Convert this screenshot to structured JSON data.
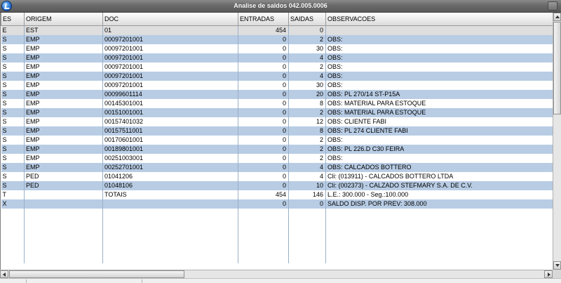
{
  "window": {
    "title": "Analise de saldos 042.005.0006"
  },
  "columns": [
    "ES",
    "ORIGEM",
    "DOC",
    "ENTRADAS",
    "SAIDAS",
    "OBSERVACOES"
  ],
  "rows": [
    [
      "E",
      "EST",
      "01",
      "454",
      "0",
      ""
    ],
    [
      "S",
      "EMP",
      "00097201001",
      "0",
      "2",
      "OBS:"
    ],
    [
      "S",
      "EMP",
      "00097201001",
      "0",
      "30",
      "OBS:"
    ],
    [
      "S",
      "EMP",
      "00097201001",
      "0",
      "4",
      "OBS:"
    ],
    [
      "S",
      "EMP",
      "00097201001",
      "0",
      "2",
      "OBS:"
    ],
    [
      "S",
      "EMP",
      "00097201001",
      "0",
      "4",
      "OBS:"
    ],
    [
      "S",
      "EMP",
      "00097201001",
      "0",
      "30",
      "OBS:"
    ],
    [
      "S",
      "EMP",
      "00099601114",
      "0",
      "20",
      "OBS: PL 270/14 ST-P15A"
    ],
    [
      "S",
      "EMP",
      "00145301001",
      "0",
      "8",
      "OBS: MATERIAL PARA ESTOQUE"
    ],
    [
      "S",
      "EMP",
      "00151001001",
      "0",
      "2",
      "OBS: MATERIAL PARA ESTOQUE"
    ],
    [
      "S",
      "EMP",
      "00157401032",
      "0",
      "12",
      "OBS: CLIENTE FABI"
    ],
    [
      "S",
      "EMP",
      "00157511001",
      "0",
      "8",
      "OBS: PL 274 CLIENTE FABI"
    ],
    [
      "S",
      "EMP",
      "00170601001",
      "0",
      "2",
      "OBS:"
    ],
    [
      "S",
      "EMP",
      "00189801001",
      "0",
      "2",
      "OBS: PL 226.D C30 FEIRA"
    ],
    [
      "S",
      "EMP",
      "00251003001",
      "0",
      "2",
      "OBS:"
    ],
    [
      "S",
      "EMP",
      "00252701001",
      "0",
      "4",
      "OBS: CALCADOS BOTTERO"
    ],
    [
      "S",
      "PED",
      "01041206",
      "0",
      "4",
      "Cli: (013911) - CALCADOS BOTTERO LTDA"
    ],
    [
      "S",
      "PED",
      "01048106",
      "0",
      "10",
      "Cli: (002373) - CALZADO STEFMARY  S.A. DE C.V."
    ],
    [
      "T",
      "",
      "TOTAIS",
      "454",
      "146",
      "L.E.: 300.000 - Seg.:100.000"
    ],
    [
      "X",
      "",
      "",
      "0",
      "0",
      "SALDO DISP. POR PREV: 308.000"
    ]
  ],
  "empty_rows": 6,
  "colors": {
    "row_alt": "#b8cce4",
    "row_selected": "#dedede",
    "titlebar": "#6a6a6a"
  }
}
